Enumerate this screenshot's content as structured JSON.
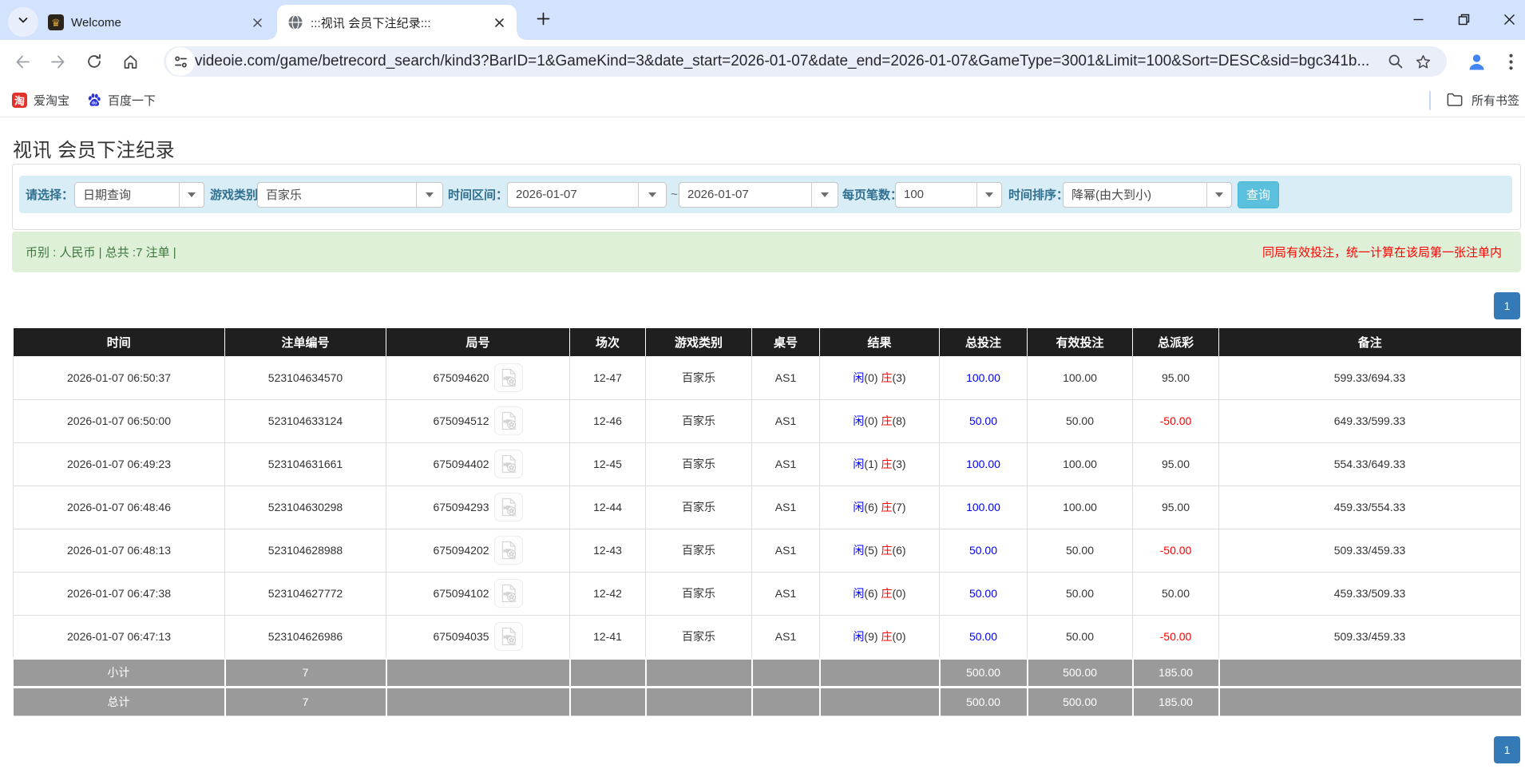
{
  "browser": {
    "tabs": [
      {
        "title": "Welcome"
      },
      {
        "title": ":::视讯 会员下注纪录:::"
      }
    ],
    "welcome_favicon_glyph": "♛",
    "url": "videoie.com/game/betrecord_search/kind3?BarID=1&GameKind=3&date_start=2026-01-07&date_end=2026-01-07&GameType=3001&Limit=100&Sort=DESC&sid=bgc341b...",
    "bookmarks": {
      "taobao_glyph": "淘",
      "taobao_label": "爱淘宝",
      "baidu_label": "百度一下",
      "all_bookmarks_label": "所有书签"
    }
  },
  "page": {
    "title": "视讯 会员下注纪录",
    "filters": {
      "select_label": "请选择：",
      "select_value": "日期查询",
      "game_label": "游戏类别",
      "game_value": "百家乐",
      "range_label": "时间区间：",
      "date_start": "2026-01-07",
      "tilde": "~",
      "date_end": "2026-01-07",
      "per_page_label": "每页笔数：",
      "per_page_value": "100",
      "sort_label": "时间排序：",
      "sort_value": "降幂(由大到小)",
      "query_button": "查询"
    },
    "summary_bar": {
      "left": "币别 : 人民币 | 总共 :7 注单 |",
      "right": "同局有效投注，统一计算在该局第一张注单内"
    },
    "pagination": {
      "page": "1"
    },
    "colors": {
      "accent_blue": "#337ab7",
      "player_blue": "#0000ff",
      "banker_red": "#ff0000",
      "filter_bar": "#d9edf7",
      "summary_green": "#dff0d8"
    },
    "table": {
      "headers": [
        "时间",
        "注单编号",
        "局号",
        "场次",
        "游戏类别",
        "桌号",
        "结果",
        "总投注",
        "有效投注",
        "总派彩",
        "备注"
      ],
      "rows": [
        {
          "time": "2026-01-07 06:50:37",
          "bet_id": "523104634570",
          "round_id": "675094620",
          "session": "12-47",
          "game_type": "百家乐",
          "table_no": "AS1",
          "result": {
            "player_label": "闲",
            "player_score": "(0)",
            "banker_label": "庄",
            "banker_score": "(3)"
          },
          "total_bet": "100.00",
          "valid_bet": "100.00",
          "payout": "95.00",
          "note": "599.33/694.33"
        },
        {
          "time": "2026-01-07 06:50:00",
          "bet_id": "523104633124",
          "round_id": "675094512",
          "session": "12-46",
          "game_type": "百家乐",
          "table_no": "AS1",
          "result": {
            "player_label": "闲",
            "player_score": "(0)",
            "banker_label": "庄",
            "banker_score": "(8)"
          },
          "total_bet": "50.00",
          "valid_bet": "50.00",
          "payout": "-50.00",
          "note": "649.33/599.33"
        },
        {
          "time": "2026-01-07 06:49:23",
          "bet_id": "523104631661",
          "round_id": "675094402",
          "session": "12-45",
          "game_type": "百家乐",
          "table_no": "AS1",
          "result": {
            "player_label": "闲",
            "player_score": "(1)",
            "banker_label": "庄",
            "banker_score": "(3)"
          },
          "total_bet": "100.00",
          "valid_bet": "100.00",
          "payout": "95.00",
          "note": "554.33/649.33"
        },
        {
          "time": "2026-01-07 06:48:46",
          "bet_id": "523104630298",
          "round_id": "675094293",
          "session": "12-44",
          "game_type": "百家乐",
          "table_no": "AS1",
          "result": {
            "player_label": "闲",
            "player_score": "(6)",
            "banker_label": "庄",
            "banker_score": "(7)"
          },
          "total_bet": "100.00",
          "valid_bet": "100.00",
          "payout": "95.00",
          "note": "459.33/554.33"
        },
        {
          "time": "2026-01-07 06:48:13",
          "bet_id": "523104628988",
          "round_id": "675094202",
          "session": "12-43",
          "game_type": "百家乐",
          "table_no": "AS1",
          "result": {
            "player_label": "闲",
            "player_score": "(5)",
            "banker_label": "庄",
            "banker_score": "(6)"
          },
          "total_bet": "50.00",
          "valid_bet": "50.00",
          "payout": "-50.00",
          "note": "509.33/459.33"
        },
        {
          "time": "2026-01-07 06:47:38",
          "bet_id": "523104627772",
          "round_id": "675094102",
          "session": "12-42",
          "game_type": "百家乐",
          "table_no": "AS1",
          "result": {
            "player_label": "闲",
            "player_score": "(6)",
            "banker_label": "庄",
            "banker_score": "(0)"
          },
          "total_bet": "50.00",
          "valid_bet": "50.00",
          "payout": "50.00",
          "note": "459.33/509.33"
        },
        {
          "time": "2026-01-07 06:47:13",
          "bet_id": "523104626986",
          "round_id": "675094035",
          "session": "12-41",
          "game_type": "百家乐",
          "table_no": "AS1",
          "result": {
            "player_label": "闲",
            "player_score": "(9)",
            "banker_label": "庄",
            "banker_score": "(0)"
          },
          "total_bet": "50.00",
          "valid_bet": "50.00",
          "payout": "-50.00",
          "note": "509.33/459.33"
        }
      ],
      "subtotal": {
        "label": "小计",
        "count": "7",
        "total_bet": "500.00",
        "valid_bet": "500.00",
        "payout": "185.00"
      },
      "total": {
        "label": "总计",
        "count": "7",
        "total_bet": "500.00",
        "valid_bet": "500.00",
        "payout": "185.00"
      }
    }
  }
}
